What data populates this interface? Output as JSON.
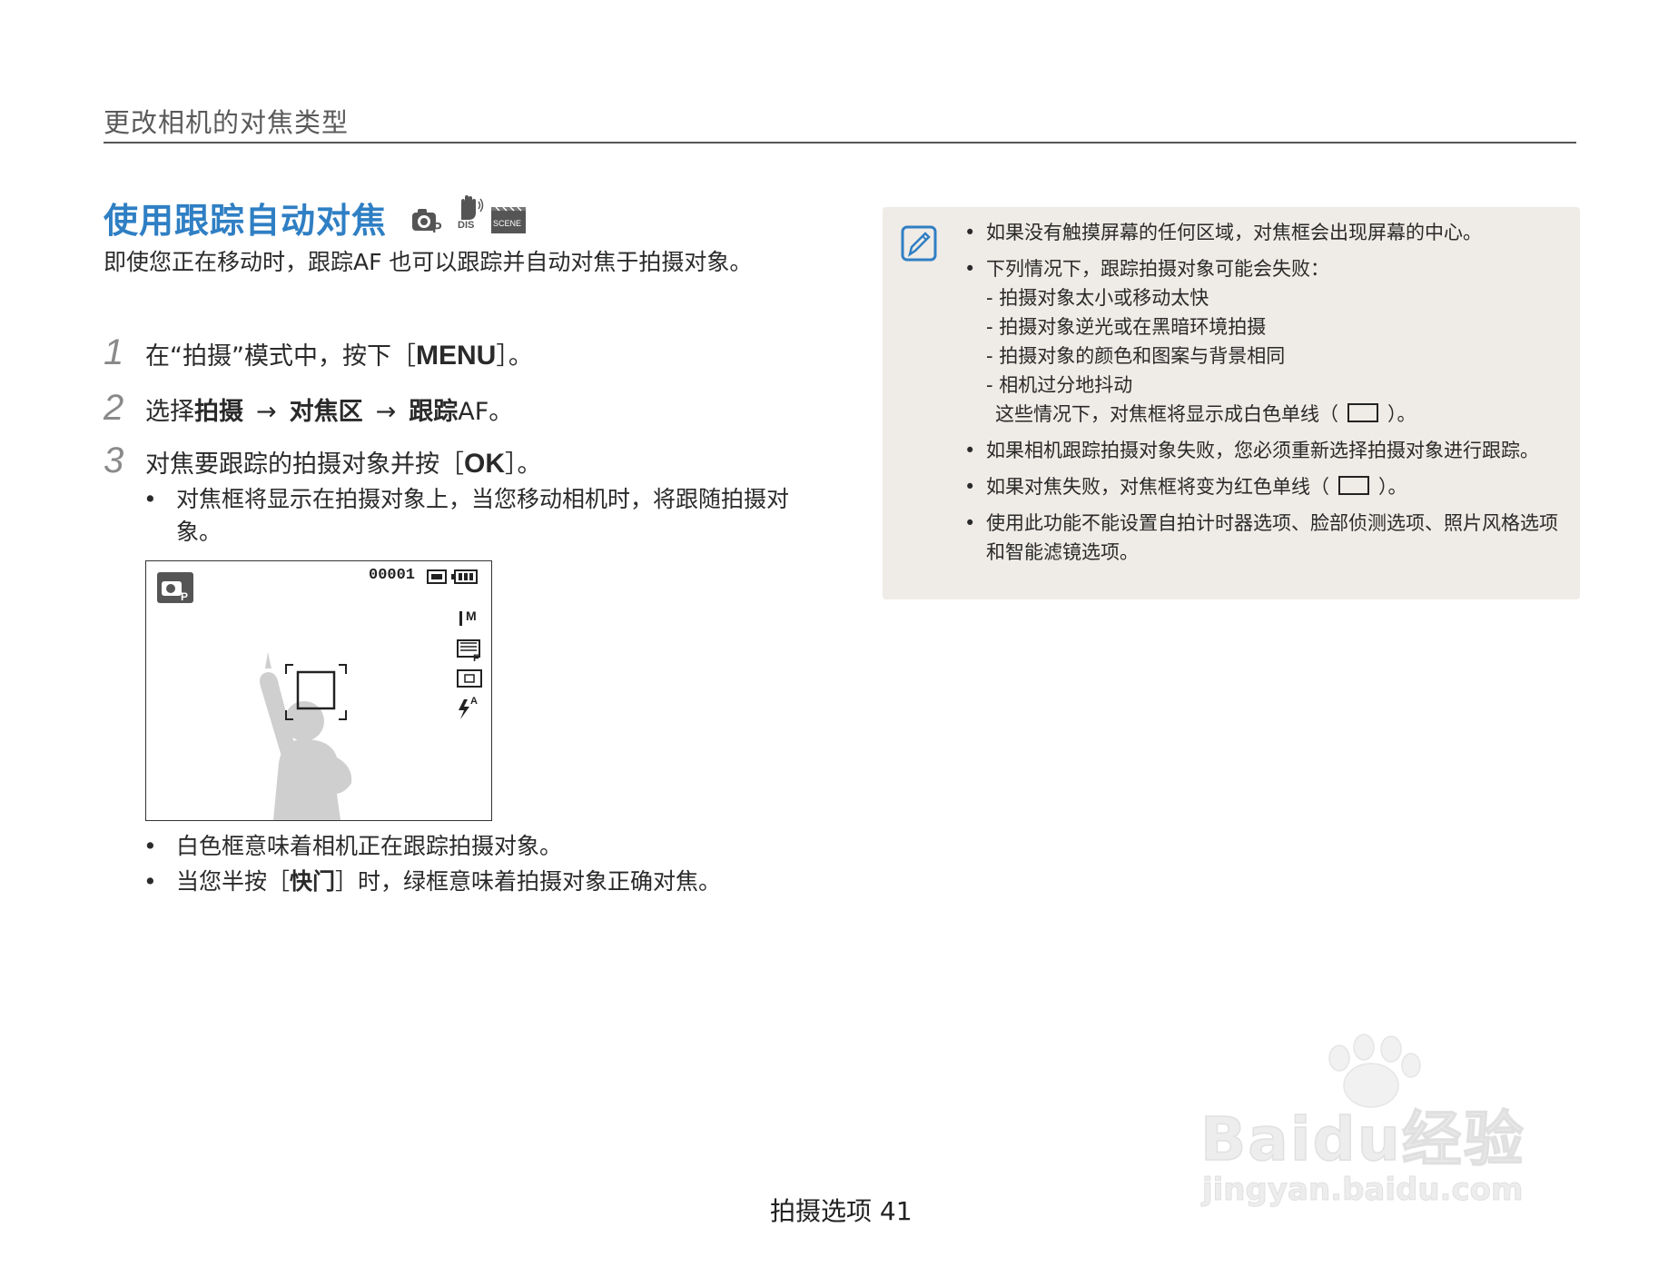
{
  "header": {
    "section_title": "更改相机的对焦类型"
  },
  "heading": {
    "title": "使用跟踪自动对焦",
    "mode_icons": [
      "camera-program-icon",
      "dis-hand-icon",
      "scene-icon"
    ],
    "mode_icon_labels": {
      "dis": "DIS",
      "scene": "SCENE"
    }
  },
  "intro": "即使您正在移动时，跟踪AF 也可以跟踪并自动对焦于拍摄对象。",
  "steps": [
    {
      "num": "1",
      "pre": "在“拍摄”模式中，按下［",
      "key": "MENU",
      "post": "］。"
    },
    {
      "num": "2",
      "pre": "选择",
      "b1": "拍摄",
      "arrow": "→",
      "b2": "对焦区",
      "b3": "跟踪",
      "post": "AF。"
    },
    {
      "num": "3",
      "pre": "对焦要跟踪的拍摄对象并按［",
      "key": "OK",
      "post": "］。"
    }
  ],
  "step3_bullets": [
    "对焦框将显示在拍摄对象上，当您移动相机时，将跟随拍摄对象。"
  ],
  "camera_screen": {
    "counter": "00001",
    "size_label": "M",
    "flash_label": "A"
  },
  "after_bullets": [
    {
      "text": "白色框意味着相机正在跟踪拍摄对象。"
    },
    {
      "pre": "当您半按［",
      "bold": "快门",
      "post": "］时，绿框意味着拍摄对象正确对焦。"
    }
  ],
  "note": {
    "items": [
      {
        "text": "如果没有触摸屏幕的任何区域，对焦框会出现屏幕的中心。"
      },
      {
        "text": "下列情况下，跟踪拍摄对象可能会失败：",
        "sub": [
          "- 拍摄对象太小或移动太快",
          "- 拍摄对象逆光或在黑暗环境拍摄",
          "- 拍摄对象的颜色和图案与背景相同",
          "- 相机过分地抖动"
        ],
        "tail_pre": "这些情况下，对焦框将显示成白色单线（",
        "tail_post": "）。"
      },
      {
        "text": "如果相机跟踪拍摄对象失败，您必须重新选择拍摄对象进行跟踪。"
      },
      {
        "pre": "如果对焦失败，对焦框将变为红色单线（",
        "post": "）。"
      },
      {
        "text": "使用此功能不能设置自拍计时器选项、脸部侦测选项、照片风格选项和智能滤镜选项。"
      }
    ]
  },
  "footer": {
    "page": "拍摄选项 41"
  },
  "watermark": {
    "brand": "Baidu经验",
    "url": "jingyan.baidu.com"
  },
  "colors": {
    "heading": "#2f7fc4",
    "note_bg": "#efebe6",
    "note_icon": "#2f7fc4"
  }
}
